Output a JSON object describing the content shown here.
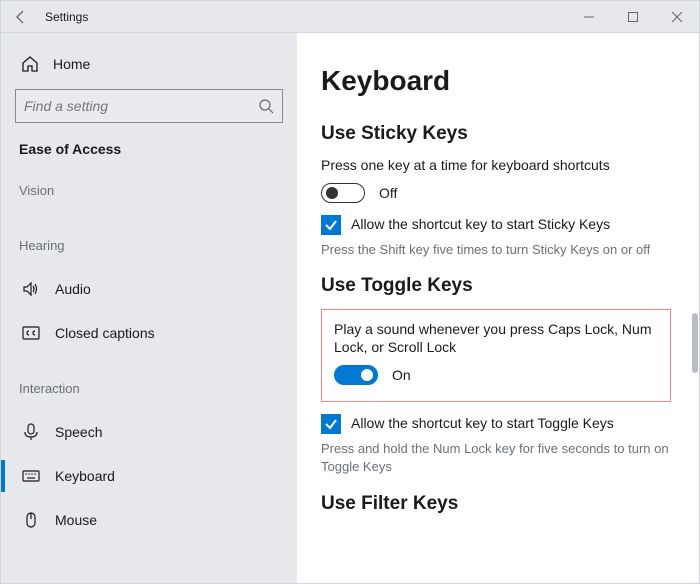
{
  "titlebar": {
    "title": "Settings"
  },
  "sidebar": {
    "home": "Home",
    "search_placeholder": "Find a setting",
    "header": "Ease of Access",
    "groups": {
      "vision": {
        "name": "Vision"
      },
      "hearing": {
        "name": "Hearing",
        "items": [
          {
            "label": "Audio",
            "id": "audio"
          },
          {
            "label": "Closed captions",
            "id": "closed-captions"
          }
        ]
      },
      "interaction": {
        "name": "Interaction",
        "items": [
          {
            "label": "Speech",
            "id": "speech"
          },
          {
            "label": "Keyboard",
            "id": "keyboard"
          },
          {
            "label": "Mouse",
            "id": "mouse"
          }
        ]
      }
    }
  },
  "main": {
    "page_title": "Keyboard",
    "sticky": {
      "title": "Use Sticky Keys",
      "desc": "Press one key at a time for keyboard shortcuts",
      "toggle_label": "Off",
      "check_label": "Allow the shortcut key to start Sticky Keys",
      "help": "Press the Shift key five times to turn Sticky Keys on or off"
    },
    "toggle_keys": {
      "title": "Use Toggle Keys",
      "desc": "Play a sound whenever you press Caps Lock, Num Lock, or Scroll Lock",
      "toggle_label": "On",
      "check_label": "Allow the shortcut key to start Toggle Keys",
      "help": "Press and hold the Num Lock key for five seconds to turn on Toggle Keys"
    },
    "filter": {
      "title": "Use Filter Keys"
    }
  }
}
